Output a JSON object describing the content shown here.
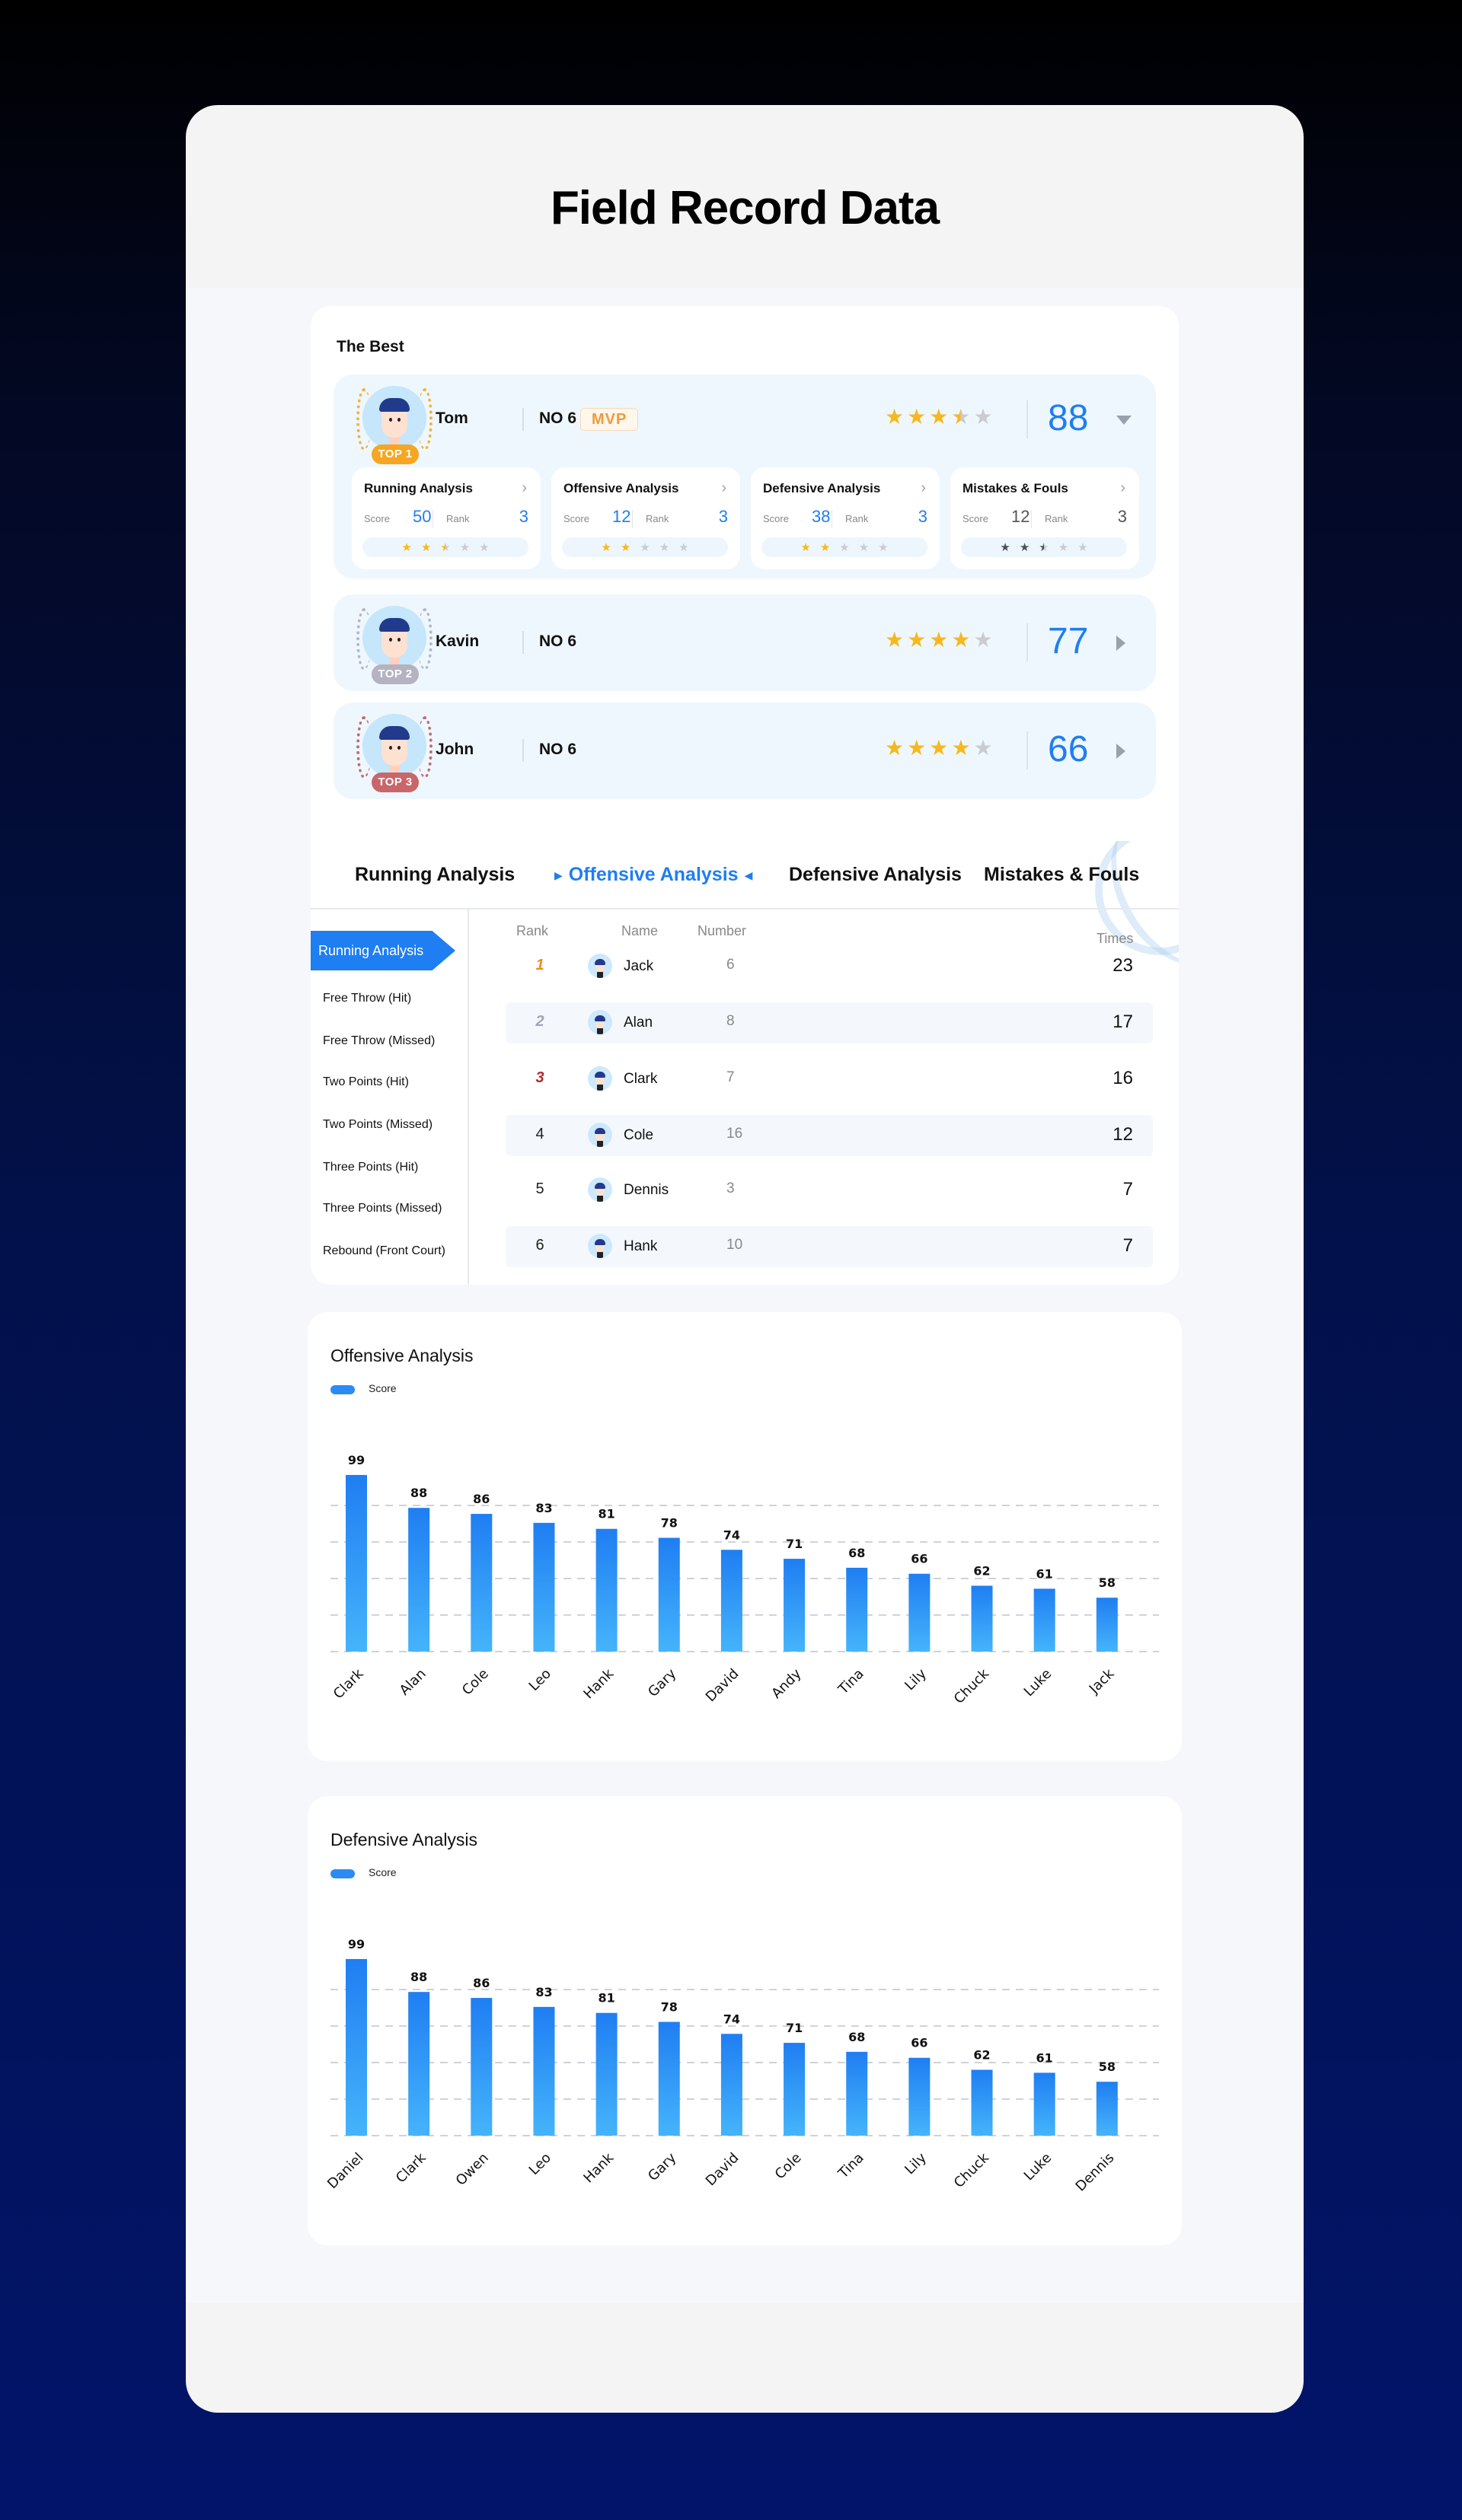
{
  "page": {
    "title": "Field Record Data"
  },
  "best": {
    "title": "The Best",
    "players": [
      {
        "badge": "TOP 1",
        "tier": "gold",
        "name": "Tom",
        "number": "NO 6",
        "tag": "MVP",
        "rating": 3.5,
        "rating_max": 5,
        "score": "88",
        "expanded": true,
        "metrics": [
          {
            "title": "Running Analysis",
            "score_label": "Score",
            "score": "50",
            "rank_label": "Rank",
            "rank": "3",
            "rating": 2.5,
            "style": "blue"
          },
          {
            "title": "Offensive Analysis",
            "score_label": "Score",
            "score": "12",
            "rank_label": "Rank",
            "rank": "3",
            "rating": 2,
            "style": "blue"
          },
          {
            "title": "Defensive Analysis",
            "score_label": "Score",
            "score": "38",
            "rank_label": "Rank",
            "rank": "3",
            "rating": 2,
            "style": "blue"
          },
          {
            "title": "Mistakes & Fouls",
            "score_label": "Score",
            "score": "12",
            "rank_label": "Rank",
            "rank": "3",
            "rating": 2.5,
            "style": "gray"
          }
        ]
      },
      {
        "badge": "TOP 2",
        "tier": "silver",
        "name": "Kavin",
        "number": "NO 6",
        "rating": 4,
        "rating_max": 5,
        "score": "77",
        "expanded": false
      },
      {
        "badge": "TOP 3",
        "tier": "bronze",
        "name": "John",
        "number": "NO 6",
        "rating": 4,
        "rating_max": 5,
        "score": "66",
        "expanded": false
      }
    ]
  },
  "ranking": {
    "tabs": [
      {
        "label": "Running Analysis",
        "active": false
      },
      {
        "label": "Offensive Analysis",
        "active": true
      },
      {
        "label": "Defensive Analysis",
        "active": false
      },
      {
        "label": "Mistakes & Fouls",
        "active": false
      }
    ],
    "sidebar": {
      "active": "Running Analysis",
      "items": [
        "Free Throw (Hit)",
        "Free Throw (Missed)",
        "Two Points (Hit)",
        "Two Points (Missed)",
        "Three Points (Hit)",
        "Three Points (Missed)",
        "Rebound (Front Court)"
      ]
    },
    "columns": {
      "rank": "Rank",
      "name": "Name",
      "number": "Number",
      "times": "Times"
    },
    "rows": [
      {
        "rank": "1",
        "name": "Jack",
        "number": "6",
        "times": "23"
      },
      {
        "rank": "2",
        "name": "Alan",
        "number": "8",
        "times": "17"
      },
      {
        "rank": "3",
        "name": "Clark",
        "number": "7",
        "times": "16"
      },
      {
        "rank": "4",
        "name": "Cole",
        "number": "16",
        "times": "12"
      },
      {
        "rank": "5",
        "name": "Dennis",
        "number": "3",
        "times": "7"
      },
      {
        "rank": "6",
        "name": "Hank",
        "number": "10",
        "times": "7"
      }
    ]
  },
  "colors": {
    "accent": "#1f7ef2",
    "bar_top": "#1f7ef2",
    "bar_bottom": "#45b4fb",
    "star": "#f7b81e",
    "gold": "#f6a623"
  },
  "chart_data": [
    {
      "type": "bar",
      "title": "Offensive Analysis",
      "legend": [
        "Score"
      ],
      "legend_position": "top-left",
      "categories": [
        "Clark",
        "Alan",
        "Cole",
        "Leo",
        "Hank",
        "Gary",
        "David",
        "Andy",
        "Tina",
        "Lily",
        "Chuck",
        "Luke",
        "Jack"
      ],
      "series": [
        {
          "name": "Score",
          "values": [
            99,
            88,
            86,
            83,
            81,
            78,
            74,
            71,
            68,
            66,
            62,
            61,
            58
          ]
        }
      ],
      "xlabel": "",
      "ylabel": "",
      "ylim": [
        40,
        100
      ],
      "grid": true
    },
    {
      "type": "bar",
      "title": "Defensive Analysis",
      "legend": [
        "Score"
      ],
      "legend_position": "top-left",
      "categories": [
        "Daniel",
        "Clark",
        "Owen",
        "Leo",
        "Hank",
        "Gary",
        "David",
        "Cole",
        "Tina",
        "Lily",
        "Chuck",
        "Luke",
        "Dennis"
      ],
      "series": [
        {
          "name": "Score",
          "values": [
            99,
            88,
            86,
            83,
            81,
            78,
            74,
            71,
            68,
            66,
            62,
            61,
            58
          ]
        }
      ],
      "xlabel": "",
      "ylabel": "",
      "ylim": [
        40,
        100
      ],
      "grid": true
    }
  ]
}
